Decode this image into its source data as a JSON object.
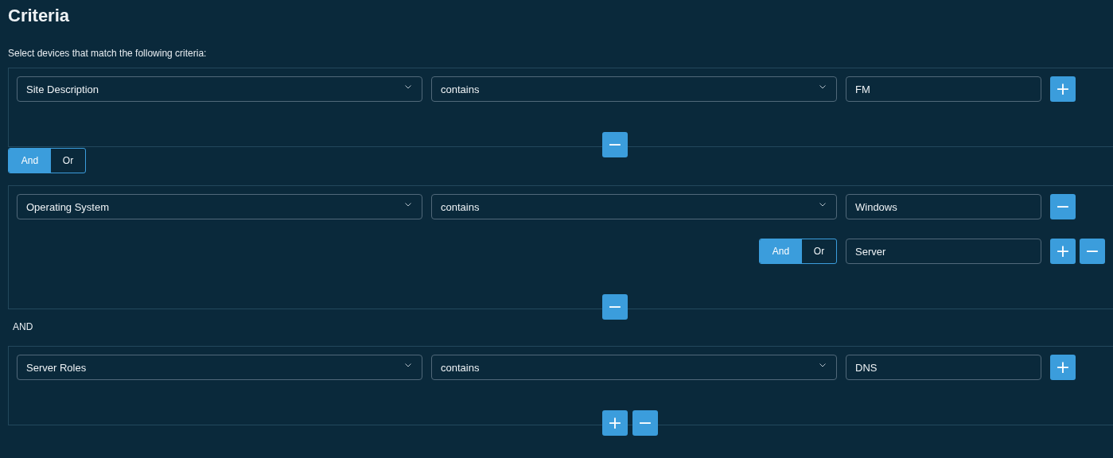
{
  "title": "Criteria",
  "instructions": "Select devices that match the following criteria:",
  "sections": [
    {
      "kind": "group",
      "conditions": [
        {
          "kind": "condition",
          "field": "Site Description",
          "operator": "contains",
          "value": "FM",
          "actions": [
            "+"
          ]
        }
      ],
      "footer_actions": [
        "−"
      ]
    },
    {
      "kind": "toggle",
      "options": [
        {
          "label": "And",
          "selected": true
        },
        {
          "label": "Or",
          "selected": false
        }
      ]
    },
    {
      "kind": "group",
      "conditions": [
        {
          "kind": "condition",
          "field": "Operating System",
          "operator": "contains",
          "value": "Windows",
          "actions": [
            "−"
          ]
        },
        {
          "kind": "sub-condition",
          "options": [
            {
              "label": "And",
              "selected": true
            },
            {
              "label": "Or",
              "selected": false
            }
          ],
          "value": "Server",
          "actions": [
            "+",
            "−"
          ]
        }
      ],
      "footer_actions": [
        "−"
      ]
    },
    {
      "kind": "label",
      "text": "AND"
    },
    {
      "kind": "group",
      "conditions": [
        {
          "kind": "condition",
          "field": "Server Roles",
          "operator": "contains",
          "value": "DNS",
          "actions": [
            "+"
          ]
        }
      ],
      "footer_actions": [
        "+",
        "−"
      ]
    }
  ]
}
